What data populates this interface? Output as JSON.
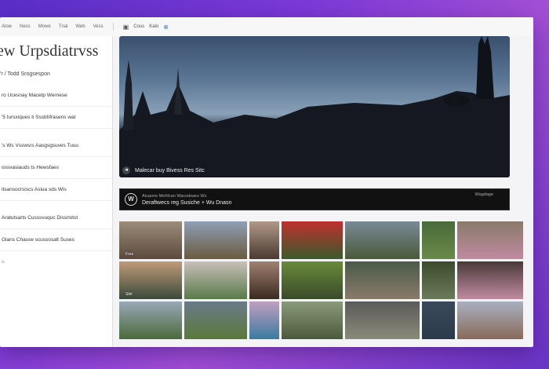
{
  "topbar": {
    "nav": [
      "Alow",
      "Ness",
      "Mowe",
      "Tnal",
      "Web",
      "Vess"
    ],
    "tools": [
      "Cous",
      "Kalo"
    ]
  },
  "sidebar": {
    "title": "ew Urpsdiatrvss",
    "subtitle": "'r / Todd Srogsespon",
    "items": [
      "ro Ucesnay Macetp Wernese",
      "'5 Iursxiques  Ii  Sssbhfrasens wat",
      "'s  Ws Vsswsrs Aasgsgsuves Tuuu",
      "ossvasiauds  ts  Hewsfaes",
      "itsansocrsiscs Asiua  sds  Wis",
      "Aratutsarts  Cusssvuquc Dissrlotst",
      "Glans  Chasse scussosalt Suses"
    ],
    "footer_dot": "ts"
  },
  "hero": {
    "caption": "Malecar buy Bivess  Res  Sitc",
    "back_icon": "back-arrow-icon"
  },
  "banner": {
    "line1": "Aluaone Mehfcan Wacsdeaes  Ws",
    "line2": "Deraftwecs reg Susiche + Wu Dnasn",
    "right": "Wagdage"
  },
  "gallery": [
    {
      "color_top": "#9b8c7a",
      "color_bottom": "#5c4a3c",
      "caption": "Fres"
    },
    {
      "color_top": "#8d9fb4",
      "color_bottom": "#6b5a40",
      "caption": ""
    },
    {
      "color_top": "#b09888",
      "color_bottom": "#4a3a30",
      "caption": ""
    },
    {
      "color_top": "#c03030",
      "color_bottom": "#3a5a2a",
      "caption": ""
    },
    {
      "color_top": "#7a8a96",
      "color_bottom": "#4a5a3a",
      "caption": ""
    },
    {
      "color_top": "#4a6a3a",
      "color_bottom": "#6a8a4a",
      "caption": ""
    },
    {
      "color_top": "#8a7a6a",
      "color_bottom": "#c08aa0",
      "caption": ""
    },
    {
      "color_top": "#c09a7a",
      "color_bottom": "#3a4a3a",
      "caption": "Sbit"
    },
    {
      "color_top": "#c8c0b8",
      "color_bottom": "#5a7a4a",
      "caption": ""
    },
    {
      "color_top": "#a08070",
      "color_bottom": "#3a2a20",
      "caption": ""
    },
    {
      "color_top": "#6a8a3a",
      "color_bottom": "#3a4a2a",
      "caption": ""
    },
    {
      "color_top": "#4a5a4a",
      "color_bottom": "#8a7a6a",
      "caption": ""
    },
    {
      "color_top": "#3a4a2a",
      "color_bottom": "#6a7a5a",
      "caption": ""
    },
    {
      "color_top": "#4a3a3a",
      "color_bottom": "#c08aa0",
      "caption": ""
    },
    {
      "color_top": "#9aa8b8",
      "color_bottom": "#4a6a3a",
      "caption": ""
    },
    {
      "color_top": "#6a7a8a",
      "color_bottom": "#5a7a3a",
      "caption": ""
    },
    {
      "color_top": "#c0a0c0",
      "color_bottom": "#3a7aa0",
      "caption": ""
    },
    {
      "color_top": "#8a9a7a",
      "color_bottom": "#4a5a3a",
      "caption": ""
    },
    {
      "color_top": "#5a5a5a",
      "color_bottom": "#8a8a7a",
      "caption": ""
    },
    {
      "color_top": "#3a4a5a",
      "color_bottom": "#2a3a4a",
      "caption": ""
    },
    {
      "color_top": "#a8b0c0",
      "color_bottom": "#8a6a5a",
      "caption": ""
    }
  ]
}
